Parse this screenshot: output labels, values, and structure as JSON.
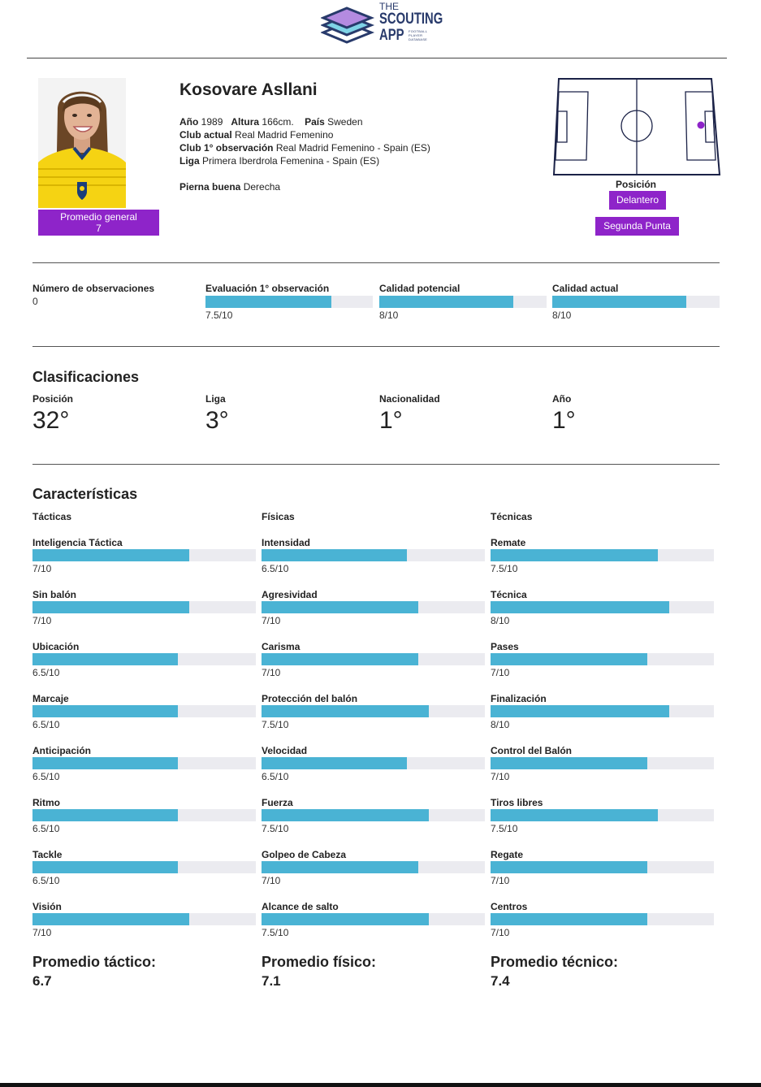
{
  "brand": {
    "line1": "THE",
    "line2": "SCOUTING",
    "line3": "APP",
    "tagline": "FOOTBALL PLAYER DATABASE",
    "color": "#283a6b"
  },
  "player": {
    "name": "Kosovare Asllani",
    "year_label": "Año",
    "year": "1989",
    "height_label": "Altura",
    "height": "166cm.",
    "country_label": "País",
    "country": "Sweden",
    "club_label": "Club actual",
    "club": "Real Madrid Femenino",
    "first_obs_club_label": "Club 1° observación",
    "first_obs_club": "Real Madrid Femenino - Spain (ES)",
    "league_label": "Liga",
    "league": "Primera Iberdrola Femenina - Spain (ES)",
    "foot_label": "Pierna buena",
    "foot": "Derecha",
    "overall_label": "Promedio general",
    "overall": "7"
  },
  "position": {
    "label": "Posición",
    "primary": "Delantero",
    "secondary": "Segunda Punta",
    "accent": "#8e24c9"
  },
  "observations": {
    "count_label": "Número de observaciones",
    "count": "0",
    "metrics": [
      {
        "label": "Evaluación 1° observación",
        "value_text": "7.5/10",
        "value": 7.5
      },
      {
        "label": "Calidad potencial",
        "value_text": "8/10",
        "value": 8
      },
      {
        "label": "Calidad actual",
        "value_text": "8/10",
        "value": 8
      }
    ]
  },
  "classifications": {
    "title": "Clasificaciones",
    "items": [
      {
        "label": "Posición",
        "value": "32°"
      },
      {
        "label": "Liga",
        "value": "3°"
      },
      {
        "label": "Nacionalidad",
        "value": "1°"
      },
      {
        "label": "Año",
        "value": "1°"
      }
    ]
  },
  "characteristics": {
    "title": "Características",
    "bar_color": "#4ab3d4",
    "track_color": "#ebebf0",
    "columns": [
      {
        "heading": "Tácticas",
        "avg_label": "Promedio táctico:",
        "avg": "6.7",
        "attrs": [
          {
            "name": "Inteligencia Táctica",
            "value_text": "7/10",
            "value": 7
          },
          {
            "name": "Sin balón",
            "value_text": "7/10",
            "value": 7
          },
          {
            "name": "Ubicación",
            "value_text": "6.5/10",
            "value": 6.5
          },
          {
            "name": "Marcaje",
            "value_text": "6.5/10",
            "value": 6.5
          },
          {
            "name": "Anticipación",
            "value_text": "6.5/10",
            "value": 6.5
          },
          {
            "name": "Ritmo",
            "value_text": "6.5/10",
            "value": 6.5
          },
          {
            "name": "Tackle",
            "value_text": "6.5/10",
            "value": 6.5
          },
          {
            "name": "Visión",
            "value_text": "7/10",
            "value": 7
          }
        ]
      },
      {
        "heading": "Físicas",
        "avg_label": "Promedio físico:",
        "avg": "7.1",
        "attrs": [
          {
            "name": "Intensidad",
            "value_text": "6.5/10",
            "value": 6.5
          },
          {
            "name": "Agresividad",
            "value_text": "7/10",
            "value": 7
          },
          {
            "name": "Carisma",
            "value_text": "7/10",
            "value": 7
          },
          {
            "name": "Protección del balón",
            "value_text": "7.5/10",
            "value": 7.5
          },
          {
            "name": "Velocidad",
            "value_text": "6.5/10",
            "value": 6.5
          },
          {
            "name": "Fuerza",
            "value_text": "7.5/10",
            "value": 7.5
          },
          {
            "name": "Golpeo de Cabeza",
            "value_text": "7/10",
            "value": 7
          },
          {
            "name": "Alcance de salto",
            "value_text": "7.5/10",
            "value": 7.5
          }
        ]
      },
      {
        "heading": "Técnicas",
        "avg_label": "Promedio técnico:",
        "avg": "7.4",
        "attrs": [
          {
            "name": "Remate",
            "value_text": "7.5/10",
            "value": 7.5
          },
          {
            "name": "Técnica",
            "value_text": "8/10",
            "value": 8
          },
          {
            "name": "Pases",
            "value_text": "7/10",
            "value": 7
          },
          {
            "name": "Finalización",
            "value_text": "8/10",
            "value": 8
          },
          {
            "name": "Control del Balón",
            "value_text": "7/10",
            "value": 7
          },
          {
            "name": "Tiros libres",
            "value_text": "7.5/10",
            "value": 7.5
          },
          {
            "name": "Regate",
            "value_text": "7/10",
            "value": 7
          },
          {
            "name": "Centros",
            "value_text": "7/10",
            "value": 7
          }
        ]
      }
    ]
  }
}
